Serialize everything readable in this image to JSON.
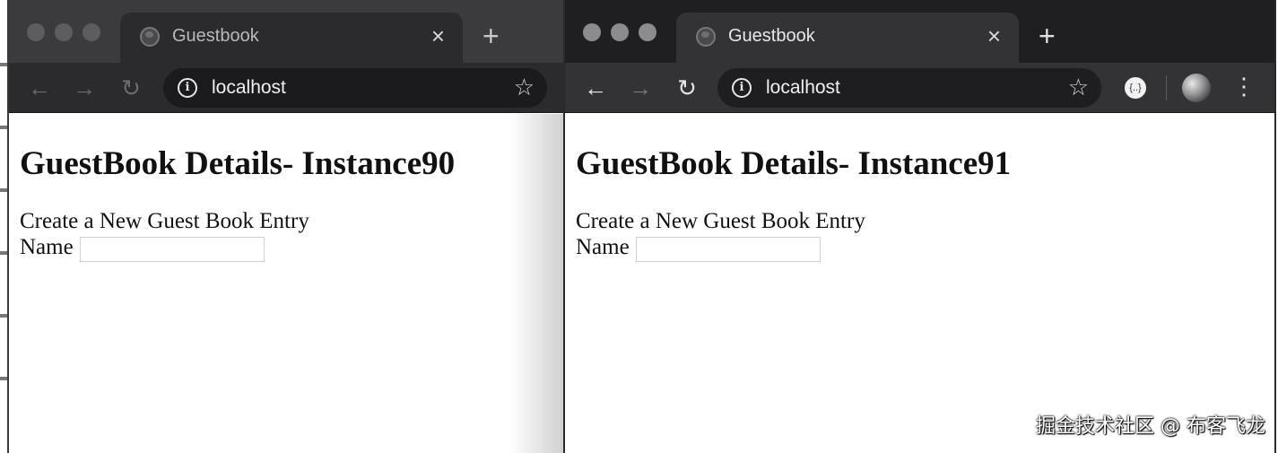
{
  "windows": [
    {
      "tab": {
        "title": "Guestbook",
        "close": "×"
      },
      "new_tab": "+",
      "nav": {
        "back": "←",
        "forward": "→",
        "reload": "↻"
      },
      "omnibox": {
        "info": "i",
        "url": "localhost",
        "star": "☆"
      },
      "page": {
        "title": "GuestBook Details- Instance90",
        "form_heading": "Create a New Guest Book Entry",
        "name_label": "Name",
        "name_value": ""
      }
    },
    {
      "tab": {
        "title": "Guestbook",
        "close": "×"
      },
      "new_tab": "+",
      "nav": {
        "back": "←",
        "forward": "→",
        "reload": "↻"
      },
      "omnibox": {
        "info": "i",
        "url": "localhost",
        "star": "☆"
      },
      "extension": "{..}",
      "menu": "⋮",
      "page": {
        "title": "GuestBook Details- Instance91",
        "form_heading": "Create a New Guest Book Entry",
        "name_label": "Name",
        "name_value": ""
      }
    }
  ],
  "watermark": "掘金技术社区 @ 布客飞龙",
  "icons": {
    "favicon": "globe-icon",
    "close": "close-icon",
    "new_tab": "plus-icon",
    "back": "arrow-left-icon",
    "forward": "arrow-right-icon",
    "reload": "reload-icon",
    "info": "info-icon",
    "star": "star-icon",
    "menu": "kebab-menu-icon"
  }
}
